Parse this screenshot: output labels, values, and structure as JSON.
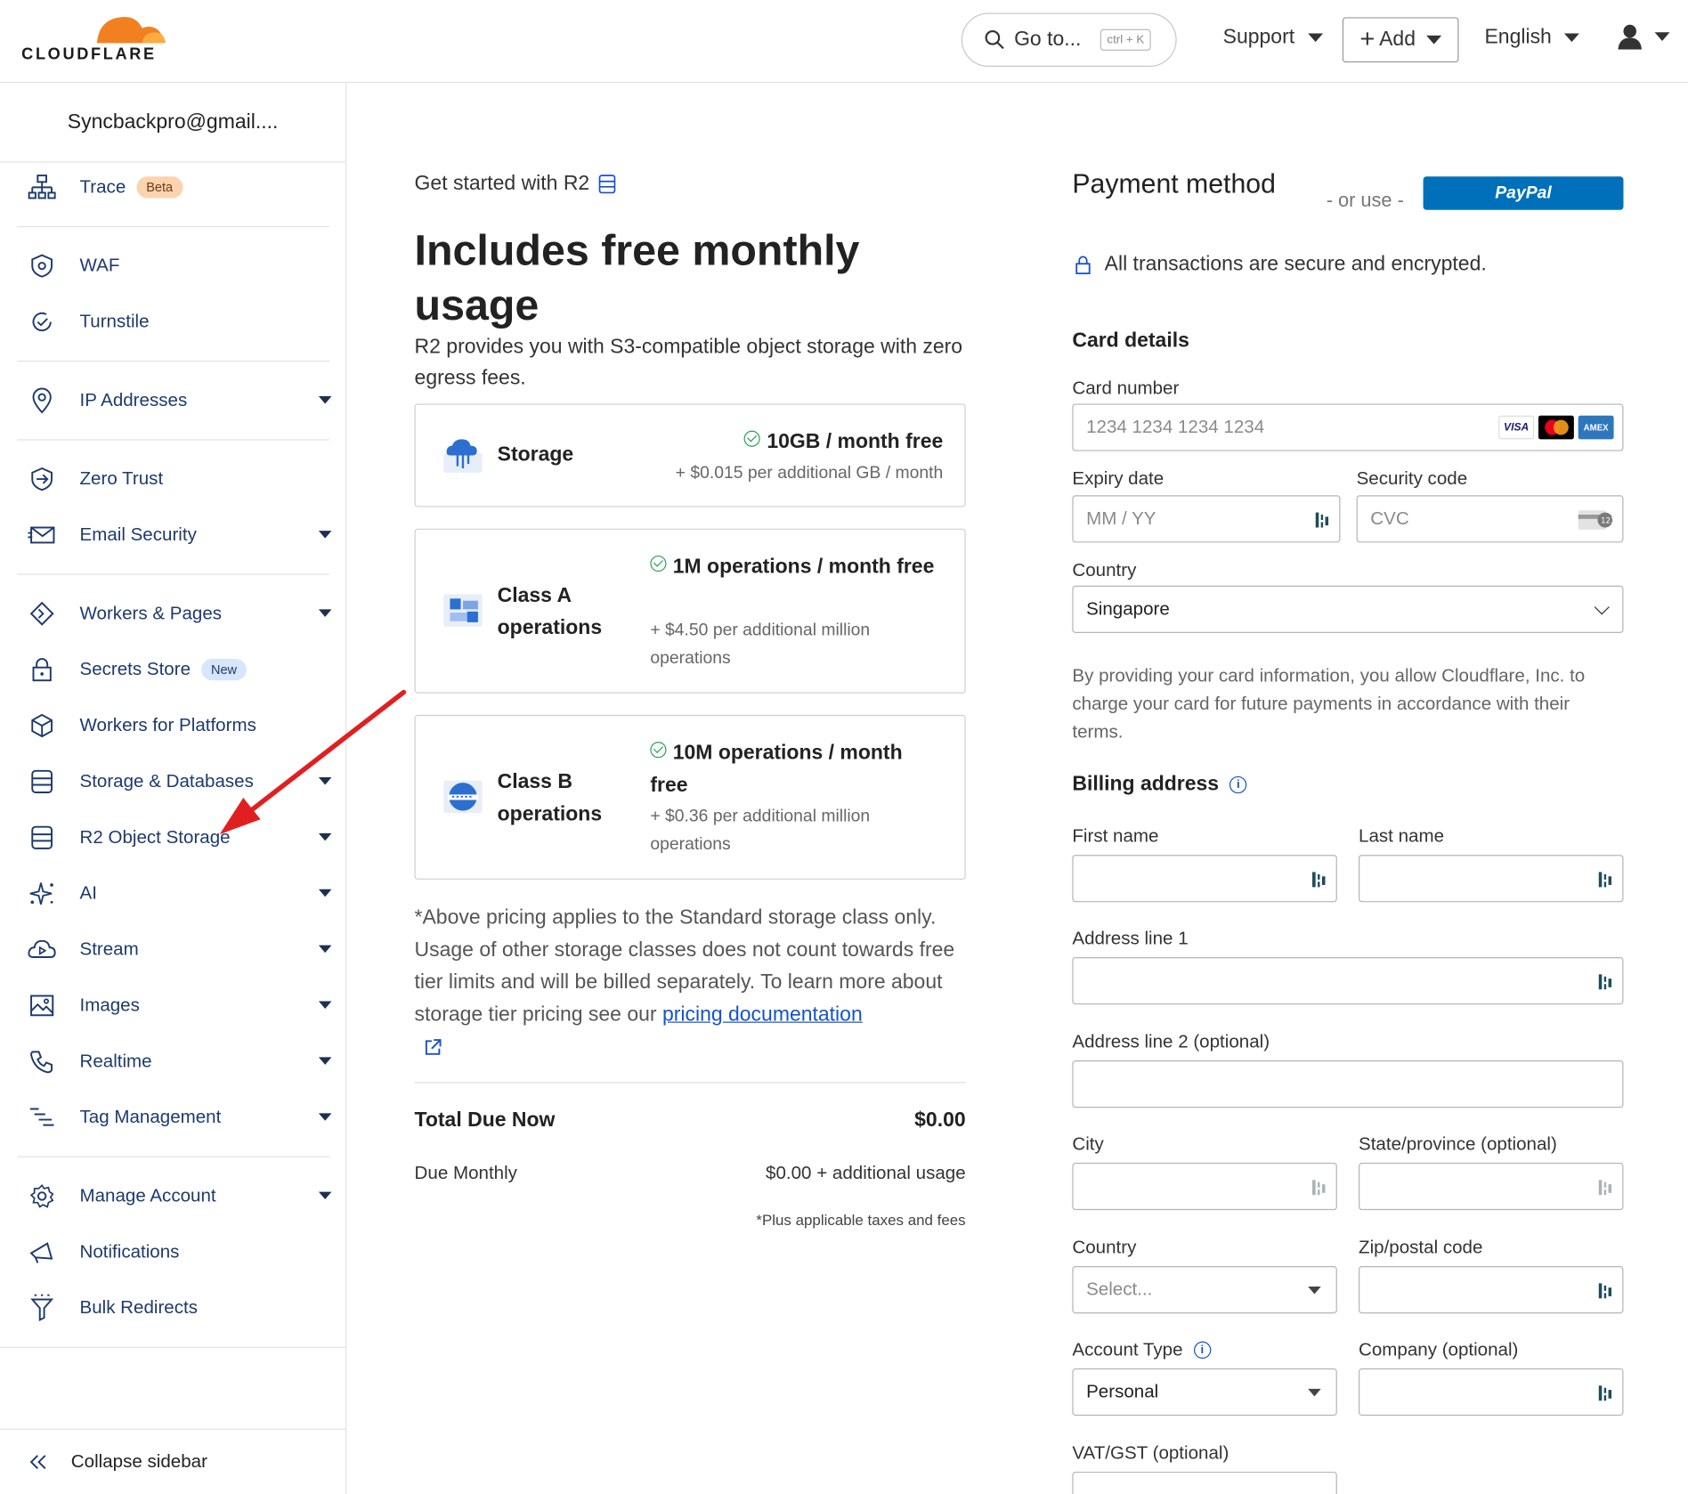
{
  "header": {
    "logo_text": "CLOUDFLARE",
    "goto_label": "Go to...",
    "goto_shortcut": "ctrl + K",
    "support_label": "Support",
    "add_label": "Add",
    "language_label": "English"
  },
  "sidebar": {
    "account": "Syncbackpro@gmail....",
    "items": [
      {
        "label": "Trace",
        "badge": "Beta",
        "icon": "trace-icon"
      },
      {
        "label": "WAF",
        "icon": "waf-icon"
      },
      {
        "label": "Turnstile",
        "icon": "turnstile-icon"
      },
      {
        "label": "IP Addresses",
        "icon": "location-pin-icon"
      },
      {
        "label": "Zero Trust",
        "icon": "zero-trust-icon"
      },
      {
        "label": "Email Security",
        "icon": "envelope-icon"
      },
      {
        "label": "Workers & Pages",
        "icon": "workers-icon"
      },
      {
        "label": "Secrets Store",
        "badge": "New",
        "icon": "lock-icon"
      },
      {
        "label": "Workers for Platforms",
        "icon": "cube-icon"
      },
      {
        "label": "Storage & Databases",
        "icon": "database-icon"
      },
      {
        "label": "R2 Object Storage",
        "icon": "r2-database-icon"
      },
      {
        "label": "AI",
        "icon": "sparkle-icon"
      },
      {
        "label": "Stream",
        "icon": "stream-cloud-icon"
      },
      {
        "label": "Images",
        "icon": "image-icon"
      },
      {
        "label": "Realtime",
        "icon": "phone-icon"
      },
      {
        "label": "Tag Management",
        "icon": "tag-list-icon"
      },
      {
        "label": "Manage Account",
        "icon": "gear-icon"
      },
      {
        "label": "Notifications",
        "icon": "megaphone-icon"
      },
      {
        "label": "Bulk Redirects",
        "icon": "funnel-icon"
      }
    ],
    "collapse_label": "Collapse sidebar"
  },
  "main": {
    "get_started": "Get started with R2",
    "hero_title": "Includes free monthly usage",
    "description": "R2 provides you with S3-compatible object storage with zero egress fees.",
    "plans": [
      {
        "name": "Storage",
        "free": "10GB / month free",
        "extra": "+ $0.015 per additional GB / month"
      },
      {
        "name": "Class A operations",
        "free": "1M operations / month free",
        "extra": "+ $4.50 per additional million operations"
      },
      {
        "name": "Class B operations",
        "free": "10M operations / month free",
        "extra": "+ $0.36 per additional million operations"
      }
    ],
    "note_text": "*Above pricing applies to the Standard storage class only. Usage of other storage classes does not count towards free tier limits and will be billed separately. To learn more about storage tier pricing see our",
    "note_link": "pricing documentation",
    "total_label": "Total Due Now",
    "total_value": "$0.00",
    "monthly_label": "Due Monthly",
    "monthly_value": "$0.00 + additional usage",
    "taxes_note": "*Plus applicable taxes and fees"
  },
  "payment": {
    "title": "Payment method",
    "or_use": "- or use -",
    "paypal_label": "PayPal",
    "secure_text": "All transactions are secure and encrypted.",
    "card_details": "Card details",
    "card_number_label": "Card number",
    "card_number_placeholder": "1234 1234 1234 1234",
    "card_brands": [
      "VISA",
      "MC",
      "AMEX"
    ],
    "expiry_label": "Expiry date",
    "expiry_placeholder": "MM / YY",
    "cvc_label": "Security code",
    "cvc_placeholder": "CVC",
    "country_label": "Country",
    "country_value": "Singapore",
    "legal_text": "By providing your card information, you allow Cloudflare, Inc. to charge your card for future payments in accordance with their terms."
  },
  "billing": {
    "title": "Billing address",
    "first_name_label": "First name",
    "last_name_label": "Last name",
    "address1_label": "Address line 1",
    "address2_label": "Address line 2 (optional)",
    "city_label": "City",
    "state_label": "State/province (optional)",
    "country_label": "Country",
    "country_placeholder": "Select...",
    "zip_label": "Zip/postal code",
    "account_type_label": "Account Type",
    "account_type_value": "Personal",
    "company_label": "Company (optional)",
    "vat_label": "VAT/GST (optional)"
  },
  "colors": {
    "brand_orange": "#f38020",
    "sidebar_text": "#1e3a6d",
    "link_blue": "#1653c7",
    "paypal_blue": "#0070ba",
    "annotation_arrow": "#e02020"
  }
}
